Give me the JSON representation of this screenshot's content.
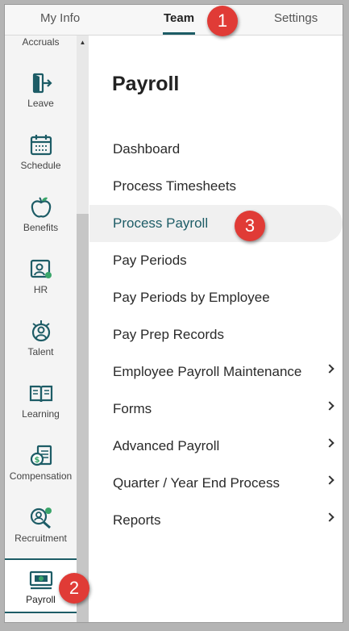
{
  "tabs": [
    {
      "label": "My Info"
    },
    {
      "label": "Team"
    },
    {
      "label": "Settings"
    }
  ],
  "callouts": [
    "1",
    "2",
    "3"
  ],
  "sidebar": {
    "items": [
      {
        "label": "Accruals",
        "icon": "accruals-icon"
      },
      {
        "label": "Leave",
        "icon": "leave-door-icon"
      },
      {
        "label": "Schedule",
        "icon": "calendar-icon"
      },
      {
        "label": "Benefits",
        "icon": "apple-icon"
      },
      {
        "label": "HR",
        "icon": "hr-person-icon"
      },
      {
        "label": "Talent",
        "icon": "talent-person-icon"
      },
      {
        "label": "Learning",
        "icon": "book-icon"
      },
      {
        "label": "Compensation",
        "icon": "money-document-icon"
      },
      {
        "label": "Recruitment",
        "icon": "recruitment-search-icon"
      },
      {
        "label": "Payroll",
        "icon": "payroll-cash-icon"
      }
    ]
  },
  "main": {
    "title": "Payroll",
    "menu": [
      {
        "label": "Dashboard",
        "has_submenu": false
      },
      {
        "label": "Process Timesheets",
        "has_submenu": false
      },
      {
        "label": "Process Payroll",
        "has_submenu": false,
        "active": true
      },
      {
        "label": "Pay Periods",
        "has_submenu": false
      },
      {
        "label": "Pay Periods by Employee",
        "has_submenu": false
      },
      {
        "label": "Pay Prep Records",
        "has_submenu": false
      },
      {
        "label": "Employee Payroll Maintenance",
        "has_submenu": true
      },
      {
        "label": "Forms",
        "has_submenu": true
      },
      {
        "label": "Advanced Payroll",
        "has_submenu": true
      },
      {
        "label": "Quarter / Year End Process",
        "has_submenu": true
      },
      {
        "label": "Reports",
        "has_submenu": true
      }
    ]
  },
  "colors": {
    "accent": "#1d5c66",
    "callout": "#e03b36"
  }
}
